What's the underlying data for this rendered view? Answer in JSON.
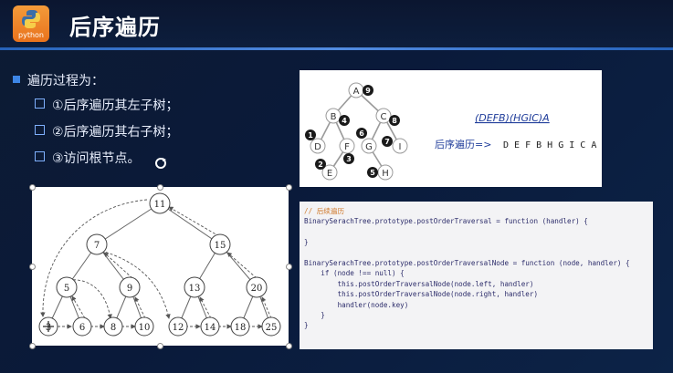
{
  "slide": {
    "logo_text": "python",
    "title": "后序遍历",
    "bullet_main": "遍历过程为：",
    "steps": [
      "①后序遍历其左子树；",
      "②后序遍历其右子树；",
      "③访问根节点。"
    ]
  },
  "abc_tree": {
    "nodes": [
      "A",
      "B",
      "C",
      "D",
      "F",
      "G",
      "I",
      "E",
      "H"
    ],
    "order_badges": [
      "9",
      "4",
      "8",
      "1",
      "3",
      "6",
      "7",
      "2",
      "5"
    ],
    "sequence": "(DEFB)(HGIC)A",
    "result_label": "后序遍历=>",
    "result_value": "D E F B H G I C A"
  },
  "bst": {
    "nodes": [
      "11",
      "7",
      "15",
      "5",
      "9",
      "13",
      "20",
      "3",
      "6",
      "8",
      "10",
      "12",
      "14",
      "18",
      "25"
    ]
  },
  "code": {
    "lines": [
      "// 后续遍历",
      "BinarySerachTree.prototype.postOrderTraversal = function (handler) {",
      "",
      "}",
      "",
      "BinarySerachTree.prototype.postOrderTraversalNode = function (node, handler) {",
      "    if (node !== null) {",
      "        this.postOrderTraversalNode(node.left, handler)",
      "        this.postOrderTraversalNode(node.right, handler)",
      "        handler(node.key)",
      "    }",
      "}"
    ]
  },
  "colors": {
    "accent": "#3d86e6",
    "node_badge": "#1a1a1a",
    "code_comment": "#d07a2c"
  }
}
